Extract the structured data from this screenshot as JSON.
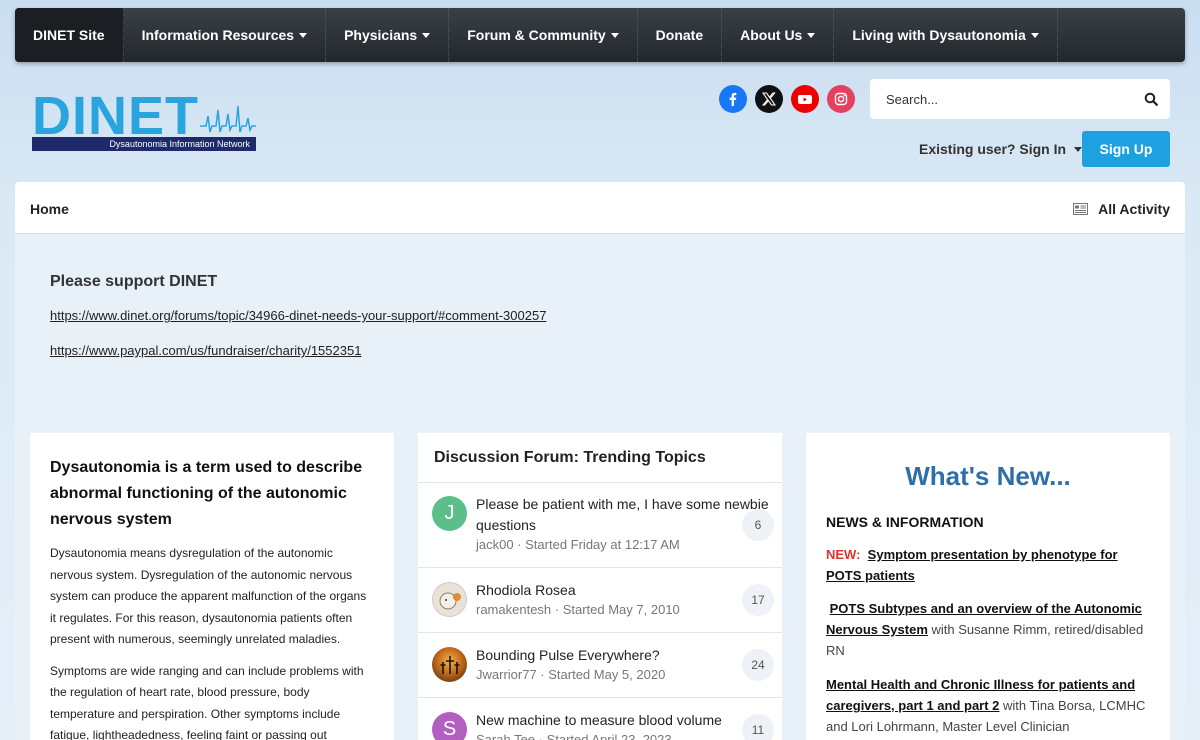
{
  "nav": {
    "items": [
      {
        "label": "DINET Site",
        "dropdown": false
      },
      {
        "label": "Information Resources",
        "dropdown": true
      },
      {
        "label": "Physicians",
        "dropdown": true
      },
      {
        "label": "Forum & Community",
        "dropdown": true
      },
      {
        "label": "Donate",
        "dropdown": false
      },
      {
        "label": "About Us",
        "dropdown": true
      },
      {
        "label": "Living with Dysautonomia",
        "dropdown": true
      }
    ]
  },
  "logo": {
    "text": "DINET",
    "tagline": "Dysautonomia Information Network",
    "colors": {
      "primary": "#2aa4dd",
      "bar": "#1f2a6b"
    }
  },
  "social": {
    "icons": [
      "facebook-icon",
      "x-icon",
      "youtube-icon",
      "instagram-icon"
    ]
  },
  "search": {
    "placeholder": "Search..."
  },
  "auth": {
    "signin_label": "Existing user? Sign In",
    "signup_label": "Sign Up"
  },
  "breadcrumb": {
    "home": "Home",
    "all_activity": "All Activity"
  },
  "support": {
    "title": "Please support DINET",
    "link1": "https://www.dinet.org/forums/topic/34966-dinet-needs-your-support/#comment-300257",
    "link2": "https://www.paypal.com/us/fundraiser/charity/1552351"
  },
  "about": {
    "title": "Dysautonomia is a term used to describe abnormal functioning of the autonomic nervous system",
    "p1": "Dysautonomia means dysregulation of the autonomic nervous system. Dysregulation of the autonomic nervous system can produce the apparent malfunction of the organs it regulates. For this reason, dysautonomia patients often present with numerous, seemingly unrelated maladies.",
    "p2": "Symptoms are wide ranging and can include problems with the regulation of heart rate, blood pressure, body temperature and perspiration. Other symptoms include fatigue, lightheadedness, feeling faint or passing out"
  },
  "trending": {
    "title": "Discussion Forum: Trending Topics",
    "topics": [
      {
        "title": "Please be patient with me, I have some newbie questions",
        "meta": "jack00 · Started Friday at 12:17 AM",
        "count": "6",
        "avatar_letter": "J",
        "avatar_color": "#5cbf8a"
      },
      {
        "title": "Rhodiola Rosea",
        "meta": "ramakentesh · Started May 7, 2010",
        "count": "17",
        "avatar_letter": "",
        "avatar_color": "#d9cfc0"
      },
      {
        "title": "Bounding Pulse Everywhere?",
        "meta": "Jwarrior77 · Started May 5, 2020",
        "count": "24",
        "avatar_letter": "",
        "avatar_color": "#b5651d"
      },
      {
        "title": "New machine to measure blood volume",
        "meta": "Sarah Tee · Started April 23, 2023",
        "count": "11",
        "avatar_letter": "S",
        "avatar_color": "#b35ec1"
      }
    ]
  },
  "whats_new": {
    "title": "What's New...",
    "section": "NEWS & INFORMATION",
    "new_tag": "NEW:",
    "item1_link": "Symptom presentation by phenotype for POTS patients",
    "item2_link": "POTS Subtypes and an overview of the Autonomic Nervous System",
    "item2_rest": " with Susanne Rimm, retired/disabled RN",
    "item3_link": "Mental Health and Chronic Illness for patients and caregivers, part 1 and part 2",
    "item3_rest": " with Tina Borsa, LCMHC and Lori Lohrmann, Master Level Clinician"
  }
}
